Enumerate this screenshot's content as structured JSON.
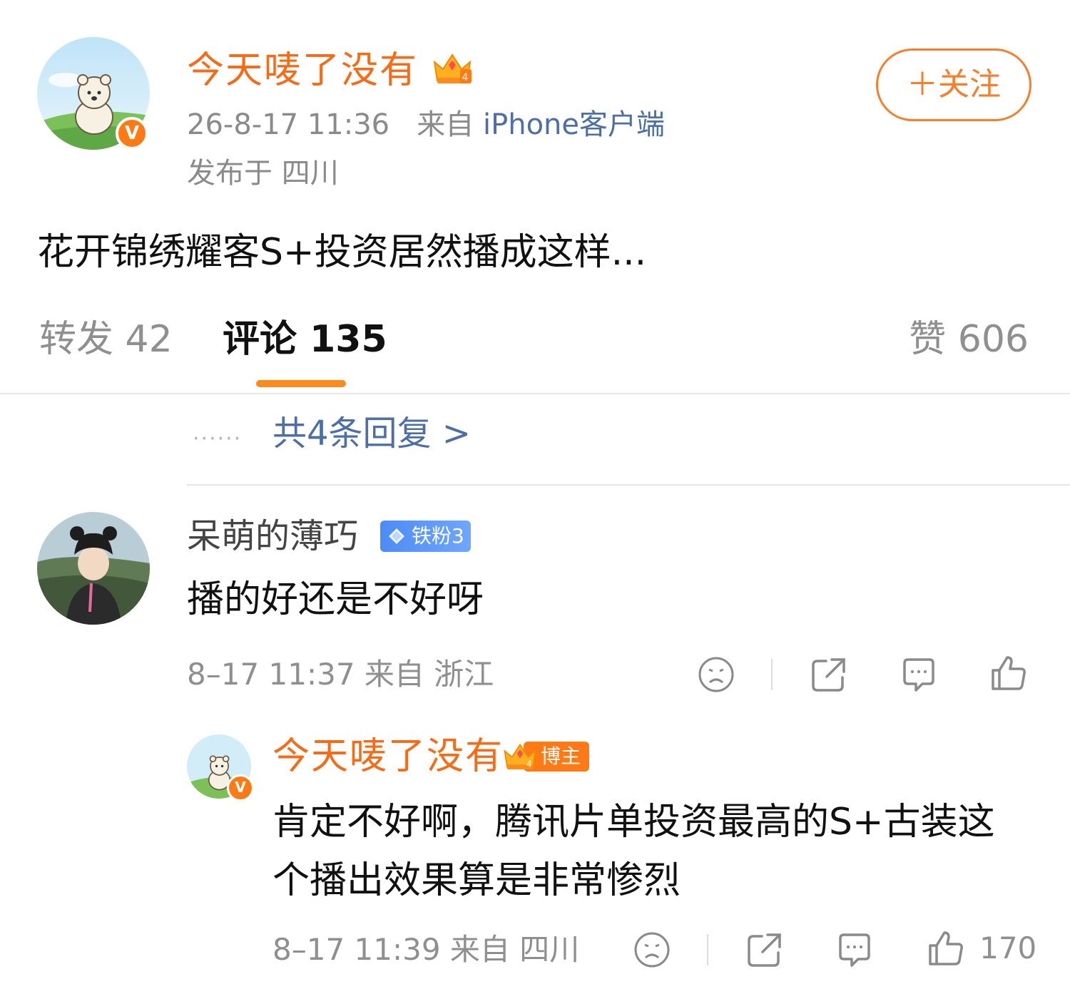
{
  "post": {
    "author_name": "今天唛了没有",
    "time": "26-8-17 11:36",
    "source_prefix": "来自",
    "source": "iPhone客户端",
    "location": "发布于 四川",
    "follow_label": "＋关注",
    "text": "花开锦绣耀客S+投资居然播成这样...",
    "crown_level": "4"
  },
  "tabs": {
    "repost": "转发 42",
    "comment": "评论 135",
    "like": "赞 606"
  },
  "replies_link": {
    "dots": "······",
    "label": "共4条回复 >"
  },
  "comment": {
    "author_name": "呆萌的薄巧",
    "fan_badge": "铁粉3",
    "text": "播的好还是不好呀",
    "meta": "8–17 11:37  来自 浙江"
  },
  "reply": {
    "author_name": "今天唛了没有",
    "badge_label": "博主",
    "crown_level": "4",
    "text": "肯定不好啊，腾讯片单投资最高的S+古装这个播出效果算是非常惨烈",
    "meta": "8–17 11:39  来自 四川",
    "like_count": "170"
  },
  "colors": {
    "accent_orange": "#f86b16",
    "link_blue": "#4d6fa5",
    "fan_badge_blue": "#4d8cf5"
  },
  "icons": [
    "sad-face-icon",
    "share-icon",
    "comment-icon",
    "thumbs-up-icon"
  ]
}
